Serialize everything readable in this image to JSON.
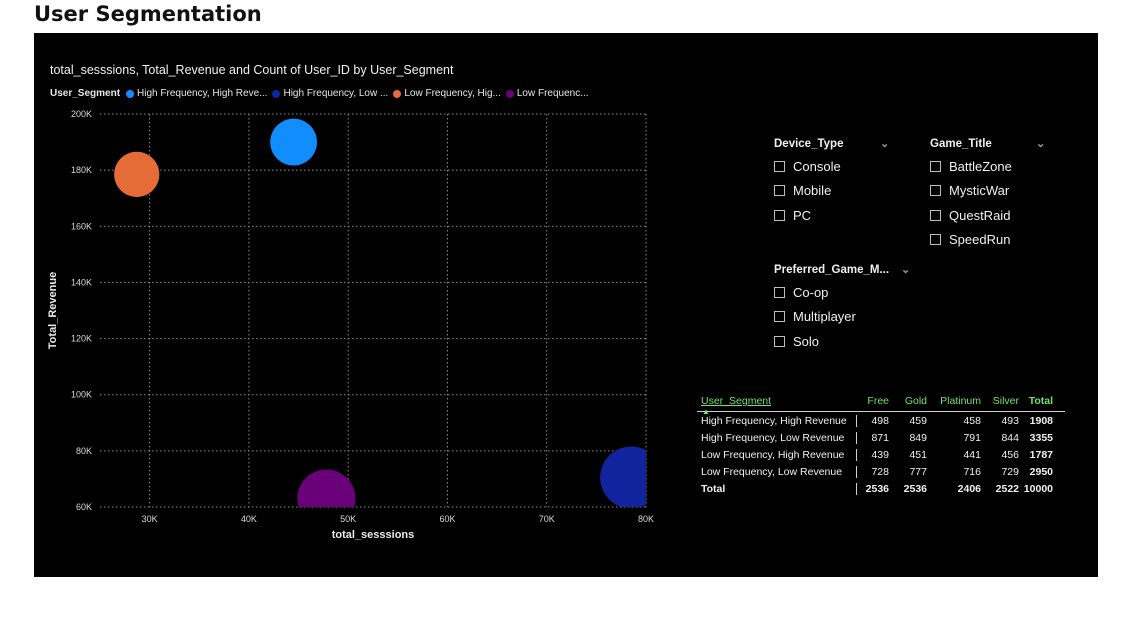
{
  "page_title": "User Segmentation",
  "chart_data": {
    "type": "scatter",
    "title": "total_sesssions, Total_Revenue and Count of User_ID by User_Segment",
    "xlabel": "total_sesssions",
    "ylabel": "Total_Revenue",
    "xlim": [
      25000,
      80000
    ],
    "ylim": [
      60000,
      200000
    ],
    "x_ticks": [
      "30K",
      "40K",
      "50K",
      "60K",
      "70K",
      "80K"
    ],
    "y_ticks": [
      "60K",
      "80K",
      "100K",
      "120K",
      "140K",
      "160K",
      "180K",
      "200K"
    ],
    "grid": true,
    "legend_title": "User_Segment",
    "legend_placement": "top-left",
    "series": [
      {
        "name": "High Frequency, High Revenue",
        "legend_label": "High Frequency, High Reve...",
        "color": "#118DFF",
        "x": 44500,
        "y": 190000,
        "count": 1908
      },
      {
        "name": "High Frequency, Low Revenue",
        "legend_label": "High Frequency, Low ...",
        "color": "#12239E",
        "x": 78500,
        "y": 70500,
        "count": 3355
      },
      {
        "name": "Low Frequency, High Revenue",
        "legend_label": "Low Frequency, Hig...",
        "color": "#E66C37",
        "x": 28700,
        "y": 178500,
        "count": 1787
      },
      {
        "name": "Low Frequency, Low Revenue",
        "legend_label": "Low Frequenc...",
        "color": "#6B007B",
        "x": 47800,
        "y": 63000,
        "count": 2950
      }
    ]
  },
  "slicers": {
    "device": {
      "title": "Device_Type",
      "options": [
        "Console",
        "Mobile",
        "PC"
      ]
    },
    "game": {
      "title": "Game_Title",
      "options": [
        "BattleZone",
        "MysticWar",
        "QuestRaid",
        "SpeedRun"
      ]
    },
    "mode": {
      "title": "Preferred_Game_M...",
      "options": [
        "Co-op",
        "Multiplayer",
        "Solo"
      ]
    }
  },
  "matrix": {
    "row_header": "User_Segment",
    "columns": [
      "Free",
      "Gold",
      "Platinum",
      "Silver",
      "Total"
    ],
    "rows": [
      {
        "label": "High Frequency, High Revenue",
        "values": [
          "498",
          "459",
          "458",
          "493",
          "1908"
        ]
      },
      {
        "label": "High Frequency, Low Revenue",
        "values": [
          "871",
          "849",
          "791",
          "844",
          "3355"
        ]
      },
      {
        "label": "Low Frequency, High Revenue",
        "values": [
          "439",
          "451",
          "441",
          "456",
          "1787"
        ]
      },
      {
        "label": "Low Frequency, Low Revenue",
        "values": [
          "728",
          "777",
          "716",
          "729",
          "2950"
        ]
      }
    ],
    "total_row": {
      "label": "Total",
      "values": [
        "2536",
        "2536",
        "2406",
        "2522",
        "10000"
      ]
    }
  }
}
